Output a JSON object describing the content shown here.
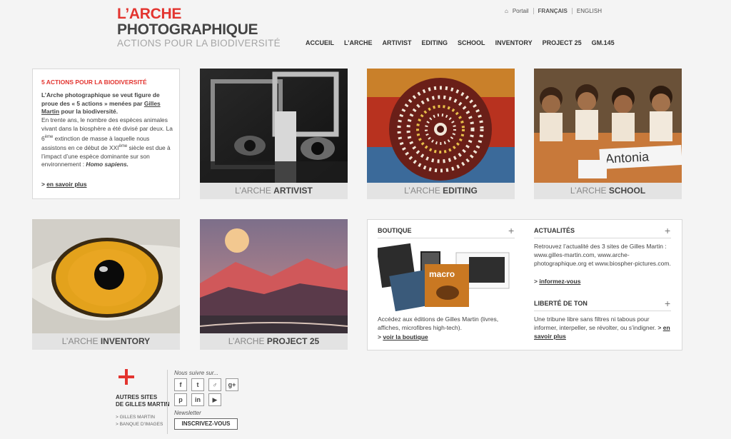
{
  "header": {
    "logo_line1": "L’ARCHE",
    "logo_line2": "PHOTOGRAPHIQUE",
    "logo_line3": "ACTIONS POUR LA BIODIVERSITÉ"
  },
  "lang": {
    "portail": "Portail",
    "fr": "FRANÇAIS",
    "en": "ENGLISH"
  },
  "nav": [
    "ACCUEIL",
    "L’ARCHE",
    "ARTIVIST",
    "EDITING",
    "SCHOOL",
    "INVENTORY",
    "PROJECT 25",
    "GM.145"
  ],
  "intro": {
    "heading": "5 ACTIONS POUR LA BIODIVERSITÉ",
    "bold1": "L’Arche photographique se veut figure de proue des « 5 actions » menées par ",
    "author": "Gilles Martin",
    "bold2": " pour la biodiversité.",
    "text1": "En trente ans, le nombre des espèces animales vivant dans la biosphère a été divisé par deux. La 6",
    "sup1": "ème",
    "text2": " extinction de masse à laquelle nous assistons en ce début de XXI",
    "sup2": "ème",
    "text3": " siècle est due à l’impact d’une espèce dominante sur son environnement : ",
    "species": "Homo sapiens.",
    "more_prefix": "> ",
    "more": "en savoir plus"
  },
  "tiles": [
    {
      "prefix": "L’ARCHE ",
      "name": "ARTIVIST"
    },
    {
      "prefix": "L’ARCHE ",
      "name": "EDITING"
    },
    {
      "prefix": "L’ARCHE ",
      "name": "SCHOOL"
    },
    {
      "prefix": "L’ARCHE ",
      "name": "INVENTORY"
    },
    {
      "prefix": "L’ARCHE ",
      "name": "PROJECT 25"
    }
  ],
  "school_sign": "Antonia",
  "boutique": {
    "title": "BOUTIQUE",
    "text": "Accédez aux éditions de Gilles Martin (livres, affiches, microfibres high-tech).",
    "link_prefix": "> ",
    "link": "voir la boutique",
    "book_label": "macro"
  },
  "actualites": {
    "title": "ACTUALITÉS",
    "text": "Retrouvez l’actualité des 3 sites de Gilles Martin : www.gilles-martin.com, www.arche-photographique.org et www.biospher-pictures.com.",
    "link_prefix": "> ",
    "link": "informez-vous"
  },
  "liberte": {
    "title": "LIBERTÉ DE TON",
    "text": "Une tribune libre sans filtres ni tabous pour informer, interpeller, se révolter, ou s’indigner. ",
    "link_prefix": "> ",
    "link": "en savoir plus"
  },
  "footer": {
    "sites_line1": "AUTRES SITES",
    "sites_line2": "DE GILLES MARTIN",
    "link1": "> GILLES MARTIN",
    "link2": "> BANQUE D’IMAGES",
    "follow": "Nous suivre sur...",
    "newsletter": "Newsletter",
    "subscribe": "INSCRIVEZ-VOUS",
    "social": [
      "f",
      "t",
      "♂",
      "g+",
      "p",
      "in",
      "▶"
    ]
  },
  "colors": {
    "accent": "#e3342f",
    "text": "#333333",
    "caption_bg": "#e3e3e3"
  }
}
